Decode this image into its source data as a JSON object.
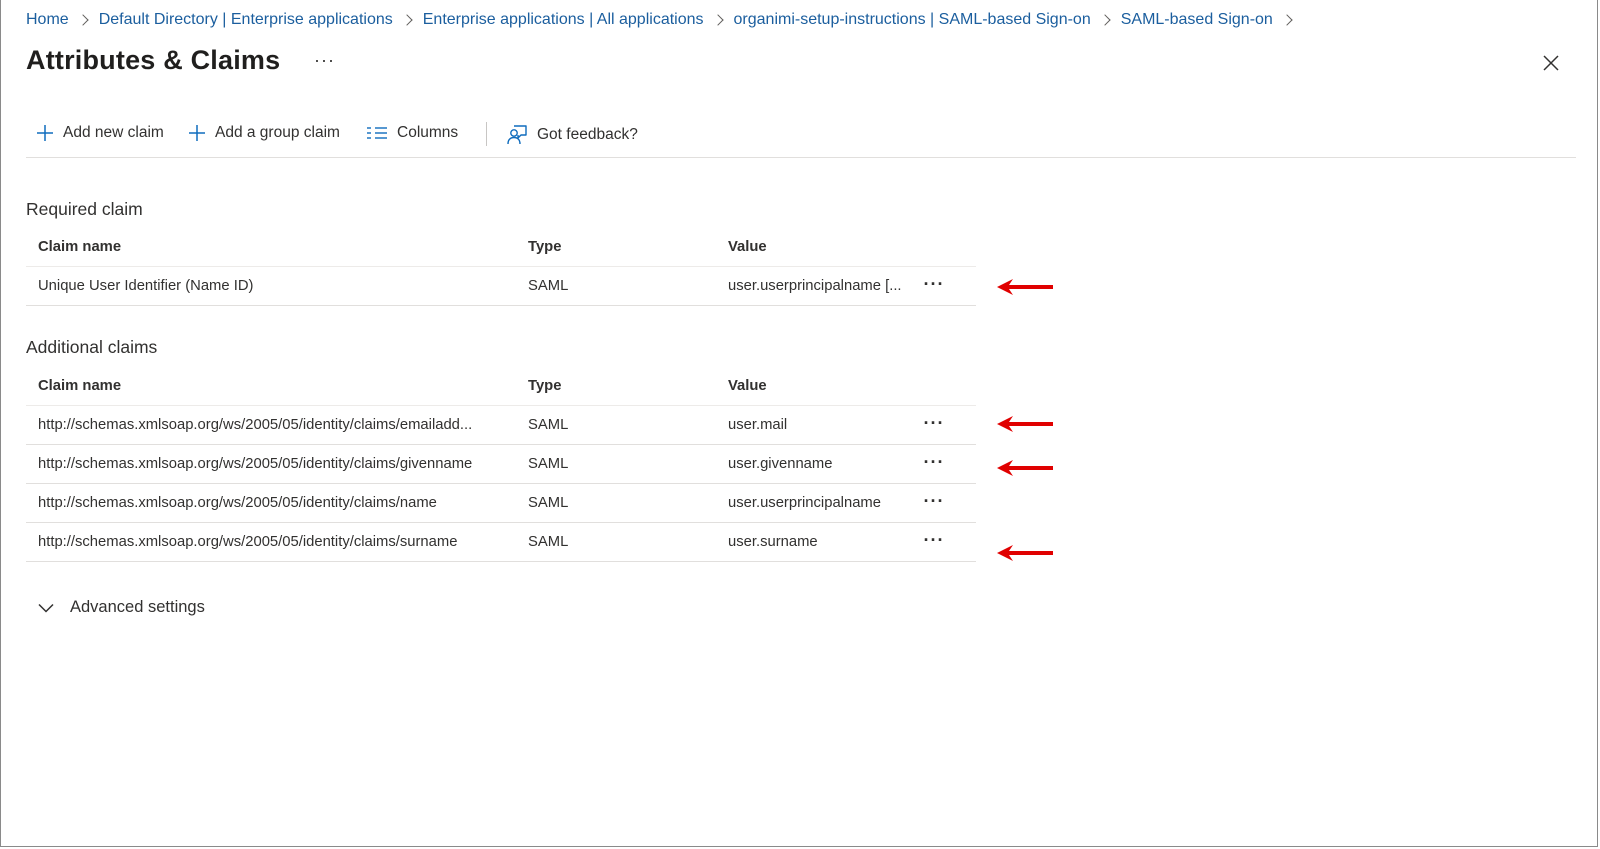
{
  "breadcrumb": [
    "Home",
    "Default Directory | Enterprise applications",
    "Enterprise applications | All applications",
    "organimi-setup-instructions | SAML-based Sign-on",
    "SAML-based Sign-on"
  ],
  "page": {
    "title": "Attributes & Claims",
    "more": "···"
  },
  "toolbar": {
    "add_new_claim": "Add new claim",
    "add_group_claim": "Add a group claim",
    "columns": "Columns",
    "feedback": "Got feedback?"
  },
  "required": {
    "title": "Required claim",
    "headers": [
      "Claim name",
      "Type",
      "Value"
    ],
    "rows": [
      {
        "name": "Unique User Identifier (Name ID)",
        "type": "SAML",
        "value": "user.userprincipalname [..."
      }
    ]
  },
  "additional": {
    "title": "Additional claims",
    "headers": [
      "Claim name",
      "Type",
      "Value"
    ],
    "rows": [
      {
        "name": "http://schemas.xmlsoap.org/ws/2005/05/identity/claims/emailadd...",
        "type": "SAML",
        "value": "user.mail"
      },
      {
        "name": "http://schemas.xmlsoap.org/ws/2005/05/identity/claims/givenname",
        "type": "SAML",
        "value": "user.givenname"
      },
      {
        "name": "http://schemas.xmlsoap.org/ws/2005/05/identity/claims/name",
        "type": "SAML",
        "value": "user.userprincipalname"
      },
      {
        "name": "http://schemas.xmlsoap.org/ws/2005/05/identity/claims/surname",
        "type": "SAML",
        "value": "user.surname"
      }
    ]
  },
  "row_more": "···",
  "advanced": {
    "label": "Advanced settings"
  },
  "colors": {
    "link": "#1b5e9e",
    "icon_blue": "#0f6cbd",
    "annotation_arrow": "#e00000"
  }
}
